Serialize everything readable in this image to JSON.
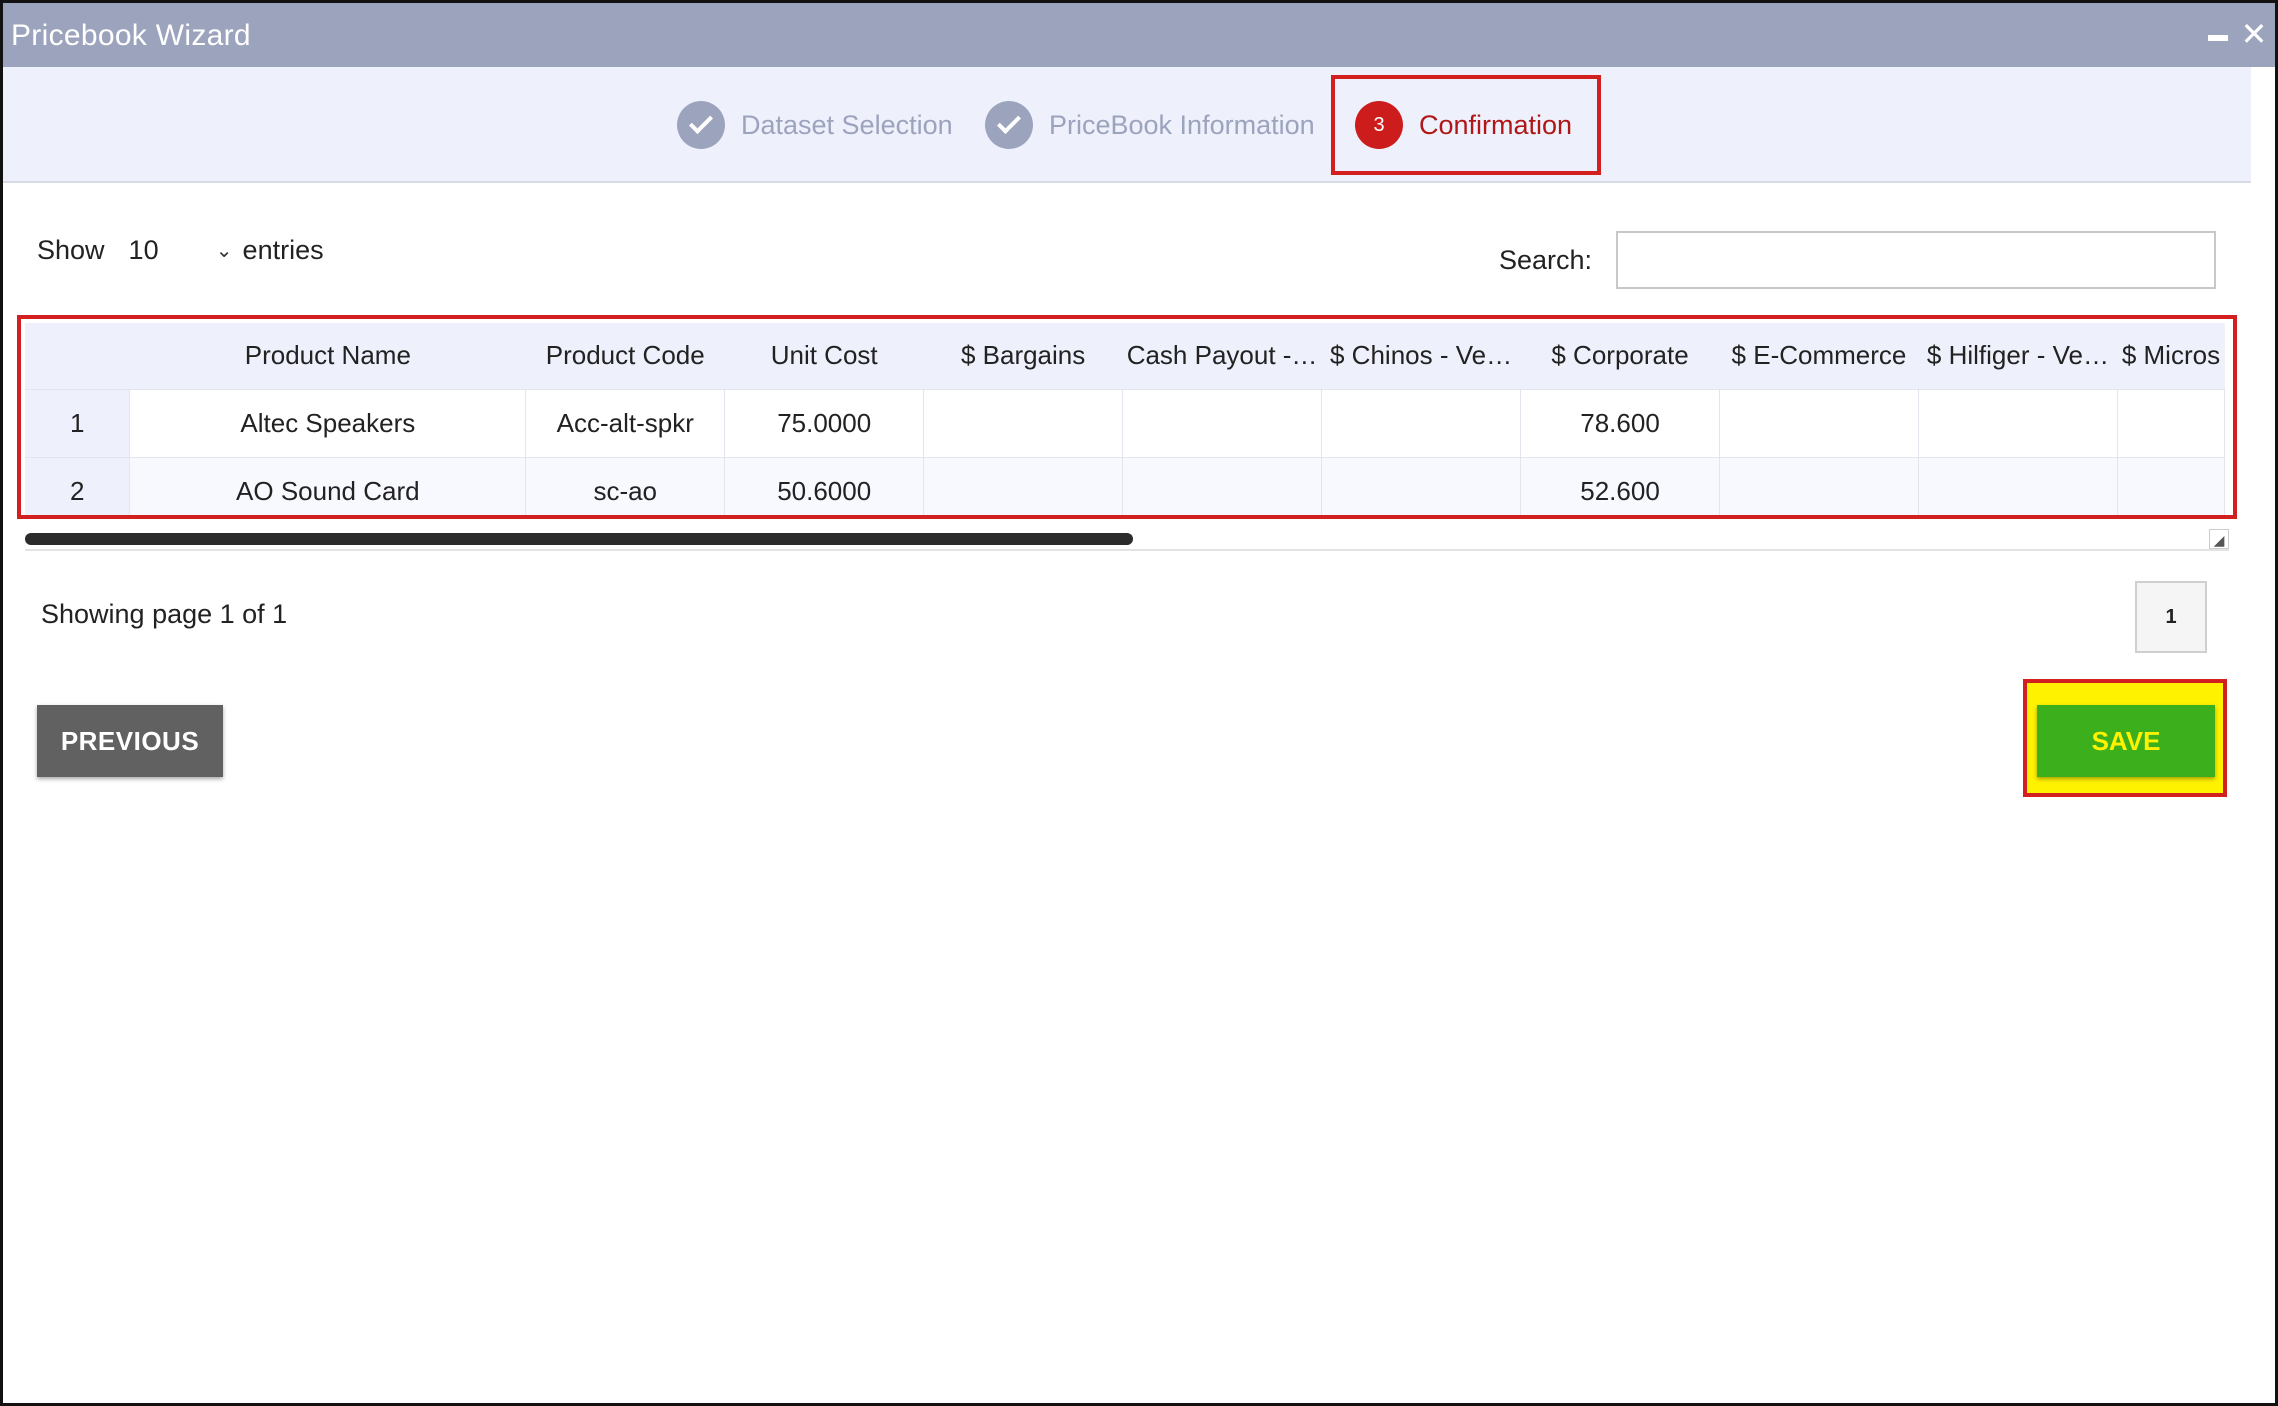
{
  "window": {
    "title": "Pricebook Wizard"
  },
  "wizard": {
    "steps": [
      {
        "number": "1",
        "label": "Dataset Selection",
        "state": "done"
      },
      {
        "number": "2",
        "label": "PriceBook Information",
        "state": "done"
      },
      {
        "number": "3",
        "label": "Confirmation",
        "state": "active"
      }
    ]
  },
  "table_controls": {
    "show_label": "Show",
    "entries_value": "10",
    "entries_label": "entries",
    "search_label": "Search:",
    "search_value": ""
  },
  "table": {
    "columns": [
      "",
      "Product Name",
      "Product Code",
      "Unit Cost",
      "$ Bargains",
      "Cash Payout -…",
      "$ Chinos - Ve…",
      "$ Corporate",
      "$ E-Commerce",
      "$ Hilfiger - Ve…",
      "$ Micros"
    ],
    "rows": [
      [
        "1",
        "Altec Speakers",
        "Acc-alt-spkr",
        "75.0000",
        "",
        "",
        "",
        "78.600",
        "",
        "",
        ""
      ],
      [
        "2",
        "AO Sound Card",
        "sc-ao",
        "50.6000",
        "",
        "",
        "",
        "52.600",
        "",
        "",
        ""
      ]
    ]
  },
  "pagination": {
    "info": "Showing page 1 of 1",
    "current_page": "1"
  },
  "actions": {
    "previous_label": "PREVIOUS",
    "save_label": "SAVE"
  },
  "colors": {
    "titlebar": "#9ca3bd",
    "active_step": "#cc1c1c",
    "save": "#3cb01c",
    "highlight": "#fff200"
  }
}
